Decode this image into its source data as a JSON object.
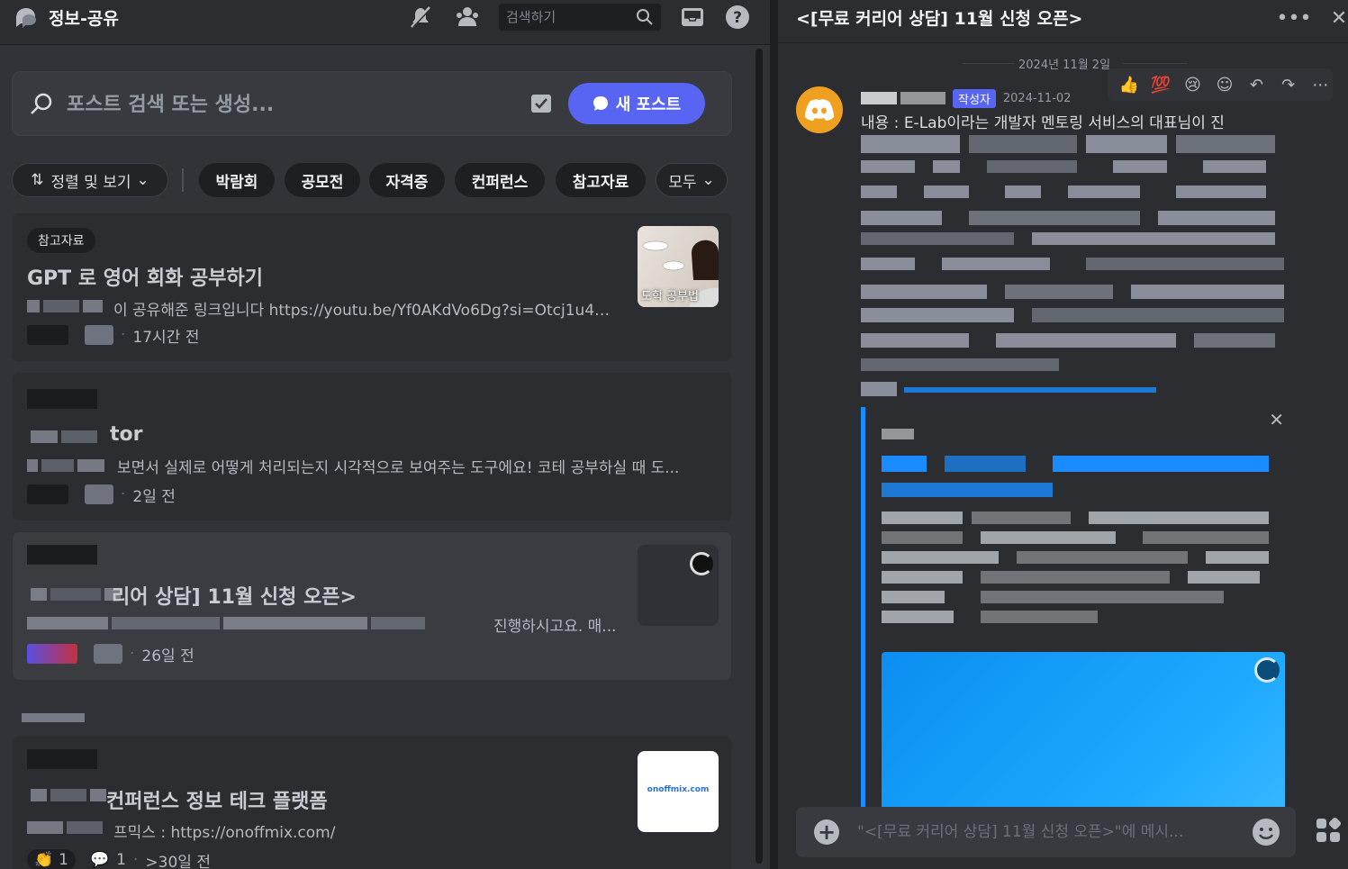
{
  "channel": {
    "name": "정보-공유"
  },
  "topbar": {
    "search_placeholder": "검색하기"
  },
  "post_search": {
    "placeholder": "포스트 검색 또는 생성...",
    "new_post_label": "새 포스트"
  },
  "filters": {
    "sort_label": "정렬 및 보기",
    "tags": [
      "박람회",
      "공모전",
      "자격증",
      "컨퍼런스",
      "참고자료"
    ],
    "all_label": "모두"
  },
  "posts": [
    {
      "tag": "참고자료",
      "title": "GPT 로 영어 회화 공부하기",
      "snippet": "이 공유해준 링크입니다 https://youtu.be/Yf0AKdVo6Dg?si=Otcj1u4k6-R...",
      "time": "17시간 전",
      "thumb_caption": "도학 공부법"
    },
    {
      "title_suffix": "tor",
      "snippet": "보면서 실제로 어떻게 처리되는지 시각적으로 보여주는 도구에요! 코테 공부하실 때 도...",
      "time": "2일 전"
    },
    {
      "title": "리어 상담] 11월 신청 오픈>",
      "snippet": "진행하시고요. 매...",
      "time": "26일 전"
    },
    {
      "title": "컨퍼런스 정보 테크 플랫폼",
      "snippet": "프믹스 : https://onoffmix.com/",
      "reaction_count": "1",
      "reply_count": "1",
      "time": ">30일 전",
      "thumb_text": "onoffmix.com"
    }
  ],
  "thread": {
    "title": "<[무료 커리어 상담] 11월 신청 오픈>",
    "date_divider": "2024년 11월 2일",
    "author_badge": "작성자",
    "timestamp": "2024-11-02",
    "first_line": "내용 : E-Lab이라는 개발자 멘토링 서비스의 대표님이 진",
    "composer_placeholder": "\"<[무료 커리어 상담] 11월 신청 오픈>\"에 메시..."
  },
  "colors": {
    "accent": "#5865f2",
    "embed_border": "#1a8cff"
  }
}
